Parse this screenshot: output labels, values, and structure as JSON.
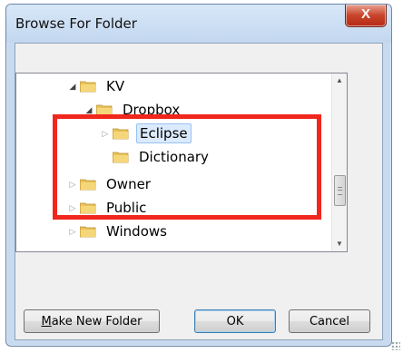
{
  "window": {
    "title": "Browse For Folder",
    "close_glyph": "X"
  },
  "tree": {
    "nodes": [
      {
        "label": "KV",
        "expanded": true
      },
      {
        "label": "Dropbox",
        "expanded": true
      },
      {
        "label": "Eclipse",
        "expanded": false,
        "selected": true
      },
      {
        "label": "Dictionary"
      },
      {
        "label": "Owner",
        "expanded": false
      },
      {
        "label": "Public",
        "expanded": false
      },
      {
        "label": "Windows",
        "expanded": false
      }
    ]
  },
  "buttons": {
    "make_new_folder": {
      "mnemonic": "M",
      "rest": "ake New Folder"
    },
    "ok": "OK",
    "cancel": "Cancel"
  },
  "icons": {
    "expanded": "triangle-down-icon",
    "collapsed": "triangle-right-icon",
    "folder": "folder-icon"
  },
  "colors": {
    "highlight": "#f1261d",
    "selection": "#dbeafd",
    "titlebar": "#c2d7ef",
    "close": "#c8442a"
  }
}
